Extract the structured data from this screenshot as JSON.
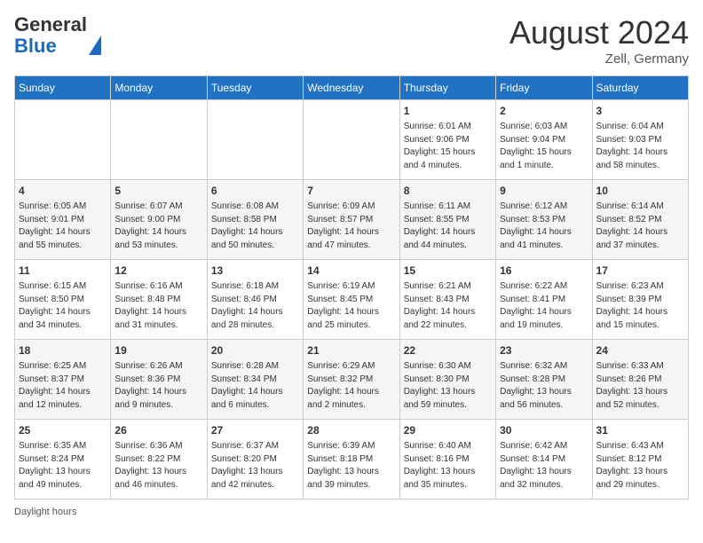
{
  "header": {
    "logo_line1": "General",
    "logo_line2": "Blue",
    "month_year": "August 2024",
    "location": "Zell, Germany"
  },
  "days_of_week": [
    "Sunday",
    "Monday",
    "Tuesday",
    "Wednesday",
    "Thursday",
    "Friday",
    "Saturday"
  ],
  "weeks": [
    [
      {
        "day": "",
        "info": ""
      },
      {
        "day": "",
        "info": ""
      },
      {
        "day": "",
        "info": ""
      },
      {
        "day": "",
        "info": ""
      },
      {
        "day": "1",
        "info": "Sunrise: 6:01 AM\nSunset: 9:06 PM\nDaylight: 15 hours\nand 4 minutes."
      },
      {
        "day": "2",
        "info": "Sunrise: 6:03 AM\nSunset: 9:04 PM\nDaylight: 15 hours\nand 1 minute."
      },
      {
        "day": "3",
        "info": "Sunrise: 6:04 AM\nSunset: 9:03 PM\nDaylight: 14 hours\nand 58 minutes."
      }
    ],
    [
      {
        "day": "4",
        "info": "Sunrise: 6:05 AM\nSunset: 9:01 PM\nDaylight: 14 hours\nand 55 minutes."
      },
      {
        "day": "5",
        "info": "Sunrise: 6:07 AM\nSunset: 9:00 PM\nDaylight: 14 hours\nand 53 minutes."
      },
      {
        "day": "6",
        "info": "Sunrise: 6:08 AM\nSunset: 8:58 PM\nDaylight: 14 hours\nand 50 minutes."
      },
      {
        "day": "7",
        "info": "Sunrise: 6:09 AM\nSunset: 8:57 PM\nDaylight: 14 hours\nand 47 minutes."
      },
      {
        "day": "8",
        "info": "Sunrise: 6:11 AM\nSunset: 8:55 PM\nDaylight: 14 hours\nand 44 minutes."
      },
      {
        "day": "9",
        "info": "Sunrise: 6:12 AM\nSunset: 8:53 PM\nDaylight: 14 hours\nand 41 minutes."
      },
      {
        "day": "10",
        "info": "Sunrise: 6:14 AM\nSunset: 8:52 PM\nDaylight: 14 hours\nand 37 minutes."
      }
    ],
    [
      {
        "day": "11",
        "info": "Sunrise: 6:15 AM\nSunset: 8:50 PM\nDaylight: 14 hours\nand 34 minutes."
      },
      {
        "day": "12",
        "info": "Sunrise: 6:16 AM\nSunset: 8:48 PM\nDaylight: 14 hours\nand 31 minutes."
      },
      {
        "day": "13",
        "info": "Sunrise: 6:18 AM\nSunset: 8:46 PM\nDaylight: 14 hours\nand 28 minutes."
      },
      {
        "day": "14",
        "info": "Sunrise: 6:19 AM\nSunset: 8:45 PM\nDaylight: 14 hours\nand 25 minutes."
      },
      {
        "day": "15",
        "info": "Sunrise: 6:21 AM\nSunset: 8:43 PM\nDaylight: 14 hours\nand 22 minutes."
      },
      {
        "day": "16",
        "info": "Sunrise: 6:22 AM\nSunset: 8:41 PM\nDaylight: 14 hours\nand 19 minutes."
      },
      {
        "day": "17",
        "info": "Sunrise: 6:23 AM\nSunset: 8:39 PM\nDaylight: 14 hours\nand 15 minutes."
      }
    ],
    [
      {
        "day": "18",
        "info": "Sunrise: 6:25 AM\nSunset: 8:37 PM\nDaylight: 14 hours\nand 12 minutes."
      },
      {
        "day": "19",
        "info": "Sunrise: 6:26 AM\nSunset: 8:36 PM\nDaylight: 14 hours\nand 9 minutes."
      },
      {
        "day": "20",
        "info": "Sunrise: 6:28 AM\nSunset: 8:34 PM\nDaylight: 14 hours\nand 6 minutes."
      },
      {
        "day": "21",
        "info": "Sunrise: 6:29 AM\nSunset: 8:32 PM\nDaylight: 14 hours\nand 2 minutes."
      },
      {
        "day": "22",
        "info": "Sunrise: 6:30 AM\nSunset: 8:30 PM\nDaylight: 13 hours\nand 59 minutes."
      },
      {
        "day": "23",
        "info": "Sunrise: 6:32 AM\nSunset: 8:28 PM\nDaylight: 13 hours\nand 56 minutes."
      },
      {
        "day": "24",
        "info": "Sunrise: 6:33 AM\nSunset: 8:26 PM\nDaylight: 13 hours\nand 52 minutes."
      }
    ],
    [
      {
        "day": "25",
        "info": "Sunrise: 6:35 AM\nSunset: 8:24 PM\nDaylight: 13 hours\nand 49 minutes."
      },
      {
        "day": "26",
        "info": "Sunrise: 6:36 AM\nSunset: 8:22 PM\nDaylight: 13 hours\nand 46 minutes."
      },
      {
        "day": "27",
        "info": "Sunrise: 6:37 AM\nSunset: 8:20 PM\nDaylight: 13 hours\nand 42 minutes."
      },
      {
        "day": "28",
        "info": "Sunrise: 6:39 AM\nSunset: 8:18 PM\nDaylight: 13 hours\nand 39 minutes."
      },
      {
        "day": "29",
        "info": "Sunrise: 6:40 AM\nSunset: 8:16 PM\nDaylight: 13 hours\nand 35 minutes."
      },
      {
        "day": "30",
        "info": "Sunrise: 6:42 AM\nSunset: 8:14 PM\nDaylight: 13 hours\nand 32 minutes."
      },
      {
        "day": "31",
        "info": "Sunrise: 6:43 AM\nSunset: 8:12 PM\nDaylight: 13 hours\nand 29 minutes."
      }
    ]
  ],
  "footer": {
    "daylight_label": "Daylight hours"
  }
}
